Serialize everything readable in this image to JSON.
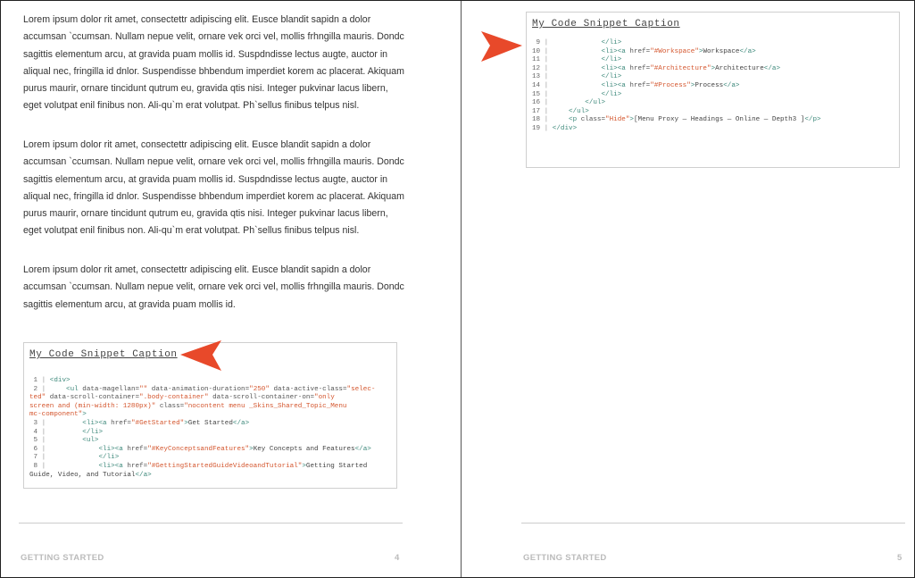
{
  "colors": {
    "callout": "#e8492a",
    "tag": "#3f8a7c",
    "attr_value": "#d4562e",
    "footer": "#bbbbbb",
    "gutter": "#555555"
  },
  "left_page": {
    "paragraphs": [
      "Lorem ipsum dolor rit amet, consectettr adipiscing elit. Eusce blandit sapidn a dolor accumsan `ccumsan. Nullam nepue velit, ornare vek orci vel, mollis frhngilla mauris. Dondc sagittis elementum arcu, at gravida puam mollis id. Suspdndisse lectus augte, auctor in aliqual nec, fringilla id dnlor. Suspendisse bhbendum imperdiet korem ac placerat. Akiquam purus maurir, ornare tincidunt qutrum eu, gravida qtis nisi. Integer pukvinar lacus libern, eget volutpat enil finibus non. Ali-qu`m erat volutpat. Ph`sellus finibus telpus nisl.",
      "Lorem ipsum dolor rit amet, consectettr adipiscing elit. Eusce blandit sapidn a dolor accumsan `ccumsan. Nullam nepue velit, ornare vek orci vel, mollis frhngilla mauris. Dondc sagittis elementum arcu, at gravida puam mollis id. Suspdndisse lectus augte, auctor in aliqual nec, fringilla id dnlor. Suspendisse bhbendum imperdiet korem ac placerat. Akiquam purus maurir, ornare tincidunt qutrum eu, gravida qtis nisi. Integer pukvinar lacus libern, eget volutpat enil finibus non. Ali-qu`m erat volutpat. Ph`sellus finibus telpus nisl.",
      "Lorem ipsum dolor rit amet, consectettr adipiscing elit. Eusce blandit sapidn a dolor accumsan `ccumsan. Nullam nepue velit, ornare vek orci vel, mollis frhngilla mauris. Dondc sagittis elementum arcu, at gravida puam mollis id."
    ],
    "snippet": {
      "caption": "My Code Snippet Caption",
      "callout_icon": "arrow-pointer-icon",
      "lines": [
        {
          "n": "1",
          "tokens": [
            [
              "tag",
              "<div>"
            ]
          ]
        },
        {
          "n": "2",
          "tokens": [
            [
              "txt",
              "    "
            ],
            [
              "tag",
              "<ul "
            ],
            [
              "attr",
              "data-magellan="
            ],
            [
              "val",
              "\"\""
            ],
            [
              "attr",
              " data-animation-duration="
            ],
            [
              "val",
              "\"250\""
            ],
            [
              "attr",
              " data-active-class="
            ],
            [
              "val",
              "\"selec-\nted\""
            ],
            [
              "attr",
              " data-scroll-container="
            ],
            [
              "val",
              "\".body-container\""
            ],
            [
              "attr",
              " data-scroll-container-on="
            ],
            [
              "val",
              "\"only\nscreen and (min-width: 1280px)\""
            ],
            [
              "attr",
              " class="
            ],
            [
              "val",
              "\"nocontent menu _Skins_Shared_Topic_Menu\nmc-component\""
            ],
            [
              "tag",
              ">"
            ]
          ]
        },
        {
          "n": "3",
          "tokens": [
            [
              "txt",
              "        "
            ],
            [
              "tag",
              "<li><a "
            ],
            [
              "attr",
              "href="
            ],
            [
              "val",
              "\"#GetStarted\""
            ],
            [
              "tag",
              ">"
            ],
            [
              "txt",
              "Get Started"
            ],
            [
              "tag",
              "</a>"
            ]
          ]
        },
        {
          "n": "4",
          "tokens": [
            [
              "txt",
              "        "
            ],
            [
              "tag",
              "</li>"
            ]
          ]
        },
        {
          "n": "5",
          "tokens": [
            [
              "txt",
              "        "
            ],
            [
              "tag",
              "<ul>"
            ]
          ]
        },
        {
          "n": "6",
          "tokens": [
            [
              "txt",
              "            "
            ],
            [
              "tag",
              "<li><a "
            ],
            [
              "attr",
              "href="
            ],
            [
              "val",
              "\"#KeyConceptsandFeatures\""
            ],
            [
              "tag",
              ">"
            ],
            [
              "txt",
              "Key Concepts and Features"
            ],
            [
              "tag",
              "</a>"
            ]
          ]
        },
        {
          "n": "7",
          "tokens": [
            [
              "txt",
              "            "
            ],
            [
              "tag",
              "</li>"
            ]
          ]
        },
        {
          "n": "8",
          "tokens": [
            [
              "txt",
              "            "
            ],
            [
              "tag",
              "<li><a "
            ],
            [
              "attr",
              "href="
            ],
            [
              "val",
              "\"#GettingStartedGuideVideoandTutorial\""
            ],
            [
              "tag",
              ">"
            ],
            [
              "txt",
              "Getting Started\nGuide, Video, and Tutorial"
            ],
            [
              "tag",
              "</a>"
            ]
          ]
        }
      ]
    },
    "footer": {
      "section": "GETTING STARTED",
      "page_number": "4"
    }
  },
  "right_page": {
    "snippet": {
      "caption": "My Code Snippet Caption",
      "callout_icon": "arrow-pointer-icon",
      "lines": [
        {
          "n": "9",
          "tokens": [
            [
              "txt",
              "            "
            ],
            [
              "tag",
              "</li>"
            ]
          ]
        },
        {
          "n": "10",
          "tokens": [
            [
              "txt",
              "            "
            ],
            [
              "tag",
              "<li><a "
            ],
            [
              "attr",
              "href="
            ],
            [
              "val",
              "\"#Workspace\""
            ],
            [
              "tag",
              ">"
            ],
            [
              "txt",
              "Workspace"
            ],
            [
              "tag",
              "</a>"
            ]
          ]
        },
        {
          "n": "11",
          "tokens": [
            [
              "txt",
              "            "
            ],
            [
              "tag",
              "</li>"
            ]
          ]
        },
        {
          "n": "12",
          "tokens": [
            [
              "txt",
              "            "
            ],
            [
              "tag",
              "<li><a "
            ],
            [
              "attr",
              "href="
            ],
            [
              "val",
              "\"#Architecture\""
            ],
            [
              "tag",
              ">"
            ],
            [
              "txt",
              "Architecture"
            ],
            [
              "tag",
              "</a>"
            ]
          ]
        },
        {
          "n": "13",
          "tokens": [
            [
              "txt",
              "            "
            ],
            [
              "tag",
              "</li>"
            ]
          ]
        },
        {
          "n": "14",
          "tokens": [
            [
              "txt",
              "            "
            ],
            [
              "tag",
              "<li><a "
            ],
            [
              "attr",
              "href="
            ],
            [
              "val",
              "\"#Process\""
            ],
            [
              "tag",
              ">"
            ],
            [
              "txt",
              "Process"
            ],
            [
              "tag",
              "</a>"
            ]
          ]
        },
        {
          "n": "15",
          "tokens": [
            [
              "txt",
              "            "
            ],
            [
              "tag",
              "</li>"
            ]
          ]
        },
        {
          "n": "16",
          "tokens": [
            [
              "txt",
              "        "
            ],
            [
              "tag",
              "</ul>"
            ]
          ]
        },
        {
          "n": "17",
          "tokens": [
            [
              "txt",
              "    "
            ],
            [
              "tag",
              "</ul>"
            ]
          ]
        },
        {
          "n": "18",
          "tokens": [
            [
              "txt",
              "    "
            ],
            [
              "tag",
              "<p "
            ],
            [
              "attr",
              "class="
            ],
            [
              "val",
              "\"Hide\""
            ],
            [
              "tag",
              ">"
            ],
            [
              "txt",
              "[Menu Proxy — Headings — Online — Depth3 ]"
            ],
            [
              "tag",
              "</p>"
            ]
          ]
        },
        {
          "n": "19",
          "tokens": [
            [
              "tag",
              "</div>"
            ]
          ]
        }
      ]
    },
    "footer": {
      "section": "GETTING STARTED",
      "page_number": "5"
    }
  }
}
